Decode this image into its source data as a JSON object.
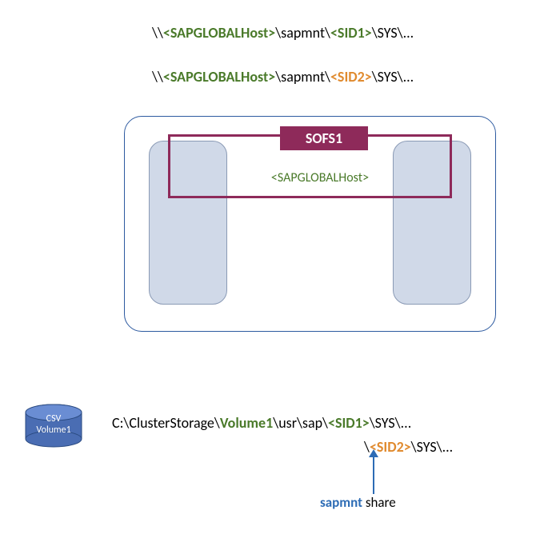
{
  "paths": {
    "line1": {
      "prefix": "\\\\",
      "host": "<SAPGLOBALHost>",
      "sapmnt": "\\sapmnt\\",
      "sid": "<SID1>",
      "suffix": "\\SYS\\..."
    },
    "line2": {
      "prefix": "\\\\",
      "host": "<SAPGLOBALHost>",
      "sapmnt": "\\sapmnt\\",
      "sid": "<SID2>",
      "suffix": "\\SYS\\..."
    }
  },
  "sofs": {
    "label": "SOFS1",
    "host": "<SAPGLOBALHost>"
  },
  "csv": {
    "label_line1": "CSV",
    "label_line2": "Volume1"
  },
  "localpath": {
    "prefix": "C:\\ClusterStorage\\",
    "vol": "Volume1",
    "mid": "\\usr\\sap\\",
    "sid1": "<SID1>",
    "suffix": "\\SYS\\...",
    "sid2_prefix": "\\",
    "sid2": "<SID2>",
    "sid2_suffix": "\\SYS\\..."
  },
  "arrow": {
    "bold": "sapmnt",
    "rest": " share"
  }
}
